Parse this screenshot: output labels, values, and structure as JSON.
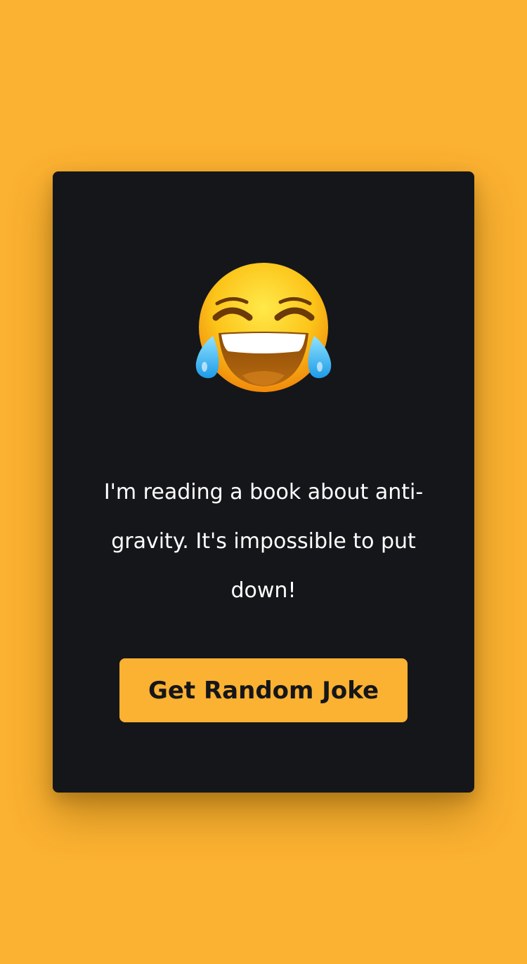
{
  "page": {
    "background_color": "#fbb131"
  },
  "card": {
    "background_color": "#15161a",
    "emoji": {
      "icon": "face-with-tears-of-joy-icon"
    },
    "joke_text": "I'm reading a book about anti-gravity. It's impossible to put down!",
    "button": {
      "label": "Get Random Joke",
      "background_color": "#fbb131",
      "text_color": "#15161a"
    }
  }
}
